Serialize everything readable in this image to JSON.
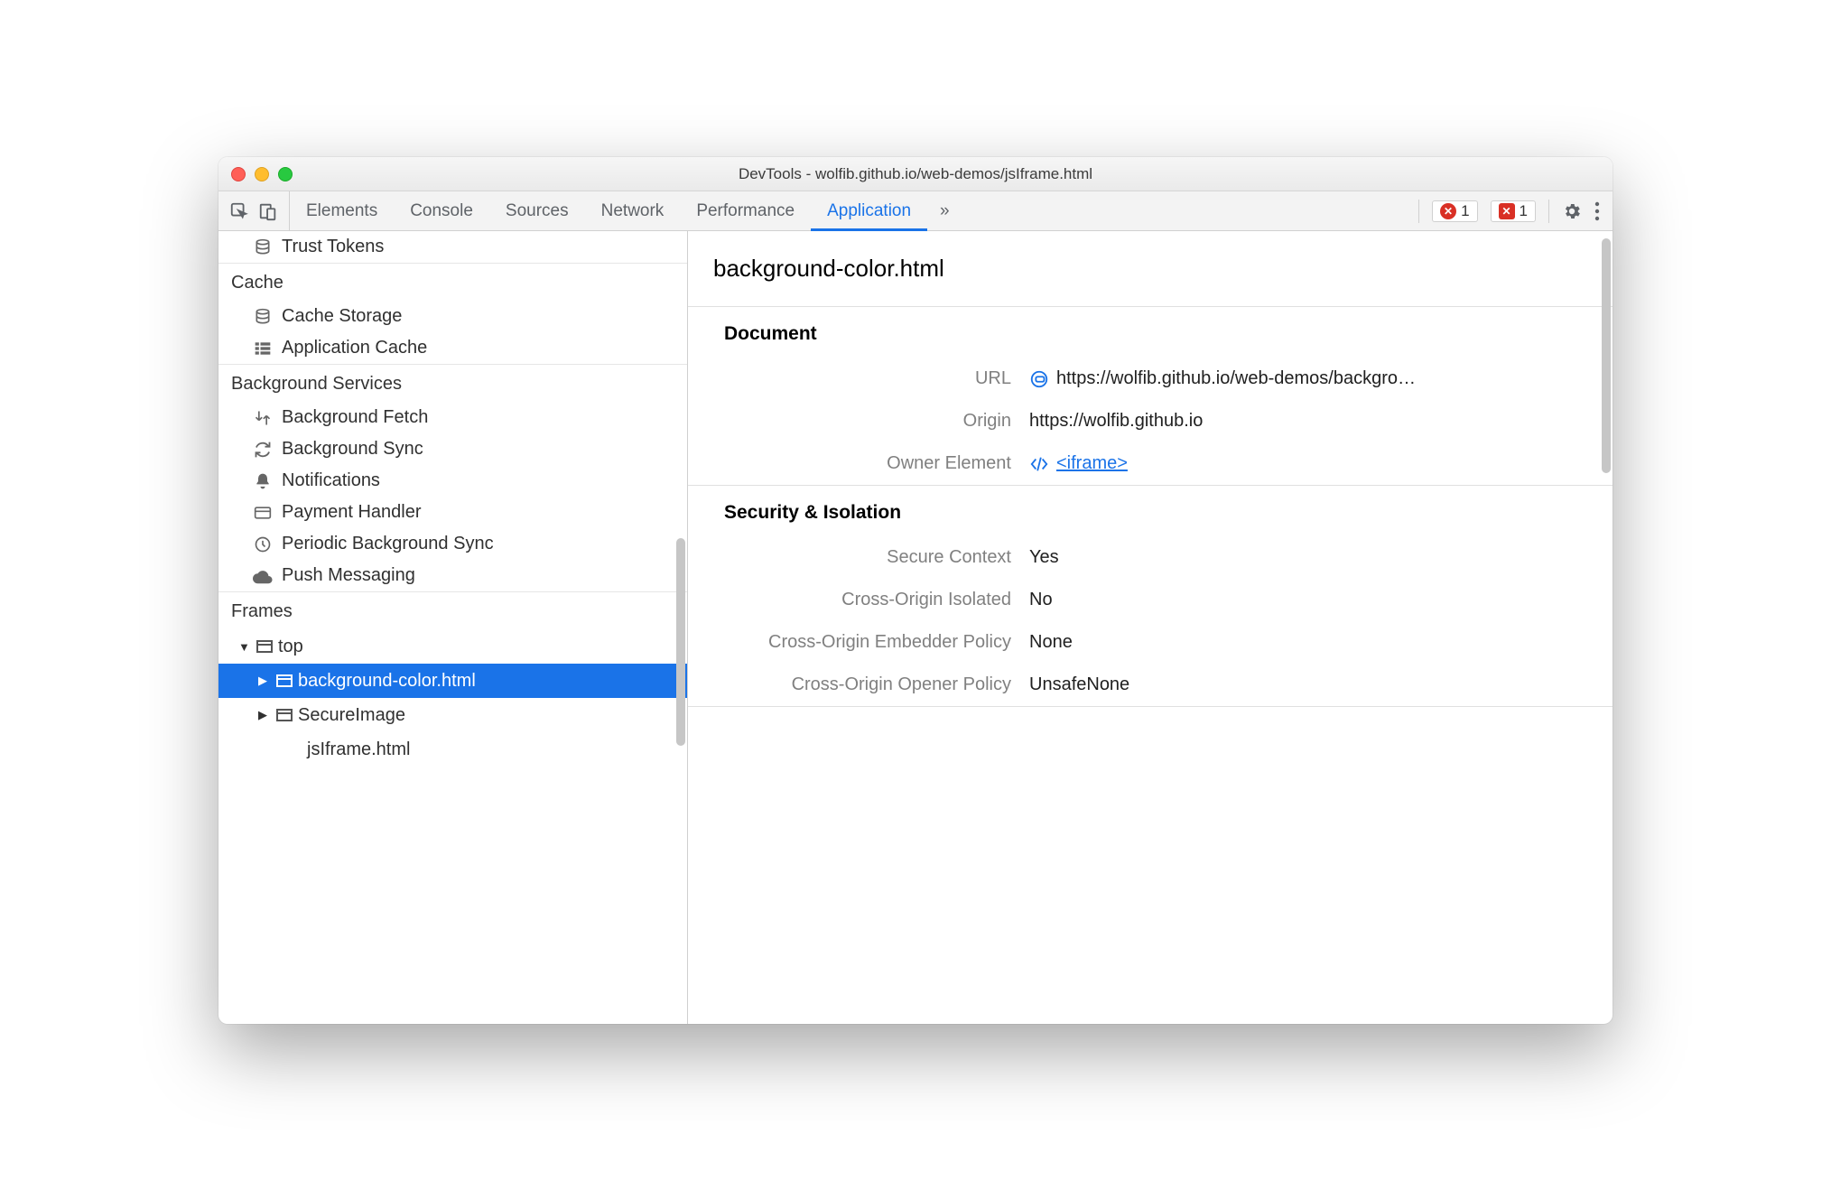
{
  "window": {
    "title": "DevTools - wolfib.github.io/web-demos/jsIframe.html"
  },
  "tabs": {
    "items": [
      "Elements",
      "Console",
      "Sources",
      "Network",
      "Performance",
      "Application"
    ],
    "overflow": "»",
    "active": 5
  },
  "toolbar": {
    "error_count_1": "1",
    "error_count_2": "1"
  },
  "sidebar": {
    "trust_tokens": "Trust Tokens",
    "cache": {
      "label": "Cache",
      "items": [
        "Cache Storage",
        "Application Cache"
      ]
    },
    "bg": {
      "label": "Background Services",
      "items": [
        "Background Fetch",
        "Background Sync",
        "Notifications",
        "Payment Handler",
        "Periodic Background Sync",
        "Push Messaging"
      ]
    },
    "frames": {
      "label": "Frames",
      "top": "top",
      "child1": "background-color.html",
      "child2": "SecureImage",
      "child3": "jsIframe.html"
    }
  },
  "details": {
    "title": "background-color.html",
    "document": {
      "label": "Document",
      "url_k": "URL",
      "url_v": "https://wolfib.github.io/web-demos/backgro…",
      "origin_k": "Origin",
      "origin_v": "https://wolfib.github.io",
      "owner_k": "Owner Element",
      "owner_v": "<iframe>"
    },
    "security": {
      "label": "Security & Isolation",
      "rows": [
        {
          "k": "Secure Context",
          "v": "Yes"
        },
        {
          "k": "Cross-Origin Isolated",
          "v": "No"
        },
        {
          "k": "Cross-Origin Embedder Policy",
          "v": "None"
        },
        {
          "k": "Cross-Origin Opener Policy",
          "v": "UnsafeNone"
        }
      ]
    }
  }
}
